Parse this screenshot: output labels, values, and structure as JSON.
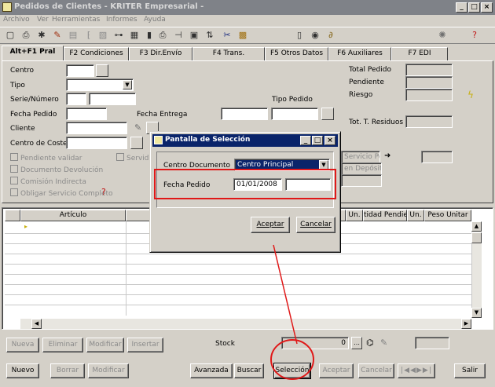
{
  "window": {
    "title": "Pedidos de Clientes - KRITER Empresarial -",
    "minimize": "_",
    "maximize": "□",
    "close": "×"
  },
  "menu": [
    "Archivo",
    "Ver",
    "Herramientas",
    "Informes",
    "Ayuda"
  ],
  "toolbar_icons": [
    "preview-icon",
    "print-icon",
    "tools-icon",
    "edit-icon",
    "copy-doc-icon",
    "code-icon",
    "edit-doc-icon",
    "tree-icon",
    "grid-icon",
    "chart-icon",
    "printer-icon",
    "stamp-icon",
    "form-icon",
    "sort-icon",
    "cut-icon",
    "clipboard-icon",
    "new-doc-icon",
    "open-icon",
    "attach-icon",
    "help-sun-icon",
    "help-question-icon"
  ],
  "tabs": [
    "Alt+F1 Pral",
    "F2 Condiciones",
    "F3 Dir.Envío",
    "F4 Trans.",
    "F5 Otros Datos",
    "F6 Auxiliares",
    "F7 EDI"
  ],
  "form": {
    "centro": "Centro",
    "tipo": "Tipo",
    "serie": "Serie/Número",
    "fecha_pedido": "Fecha Pedido",
    "fecha_entrega": "Fecha Entrega",
    "cliente": "Cliente",
    "centro_coste": "Centro de Coste",
    "tipo_pedido": "Tipo Pedido",
    "total_pedido": "Total Pedido",
    "pendiente": "Pendiente",
    "riesgo": "Riesgo",
    "tot_residuos": "Tot. T. Residuos",
    "servicio_ped": "Servicio Ped",
    "en_deposito": "en Depósito",
    "servicio_partial": "Servid"
  },
  "checkboxes": [
    "Pendiente validar",
    "Documento Devolución",
    "Comisión Indirecta",
    "Obligar Servicio Completo"
  ],
  "grid": {
    "headers": [
      "Artículo",
      "Un.",
      "tidad Pendie",
      "Un.",
      "Peso Unitar"
    ]
  },
  "lower_buttons": {
    "nueva": "Nueva",
    "eliminar": "Eliminar",
    "modificar": "Modificar",
    "insertar": "Insertar",
    "stock": "Stock",
    "stock_value": "0"
  },
  "bottom_buttons": {
    "nuevo": "Nuevo",
    "borrar": "Borrar",
    "modificar": "Modificar",
    "avanzada": "Avanzada",
    "buscar": "Buscar",
    "seleccion": "Selección",
    "aceptar": "Aceptar",
    "cancelar": "Cancelar",
    "salir": "Salir"
  },
  "dialog": {
    "title": "Pantalla de Selección",
    "centro_label": "Centro Documento",
    "centro_value": "Centro Principal",
    "fecha_label": "Fecha Pedido",
    "fecha_value": "01/01/2008",
    "aceptar": "Aceptar",
    "cancelar": "Cancelar"
  },
  "colors": {
    "annotation": "#e01818",
    "dialog_title": "#0a246a",
    "window_title": "#7f8288"
  }
}
